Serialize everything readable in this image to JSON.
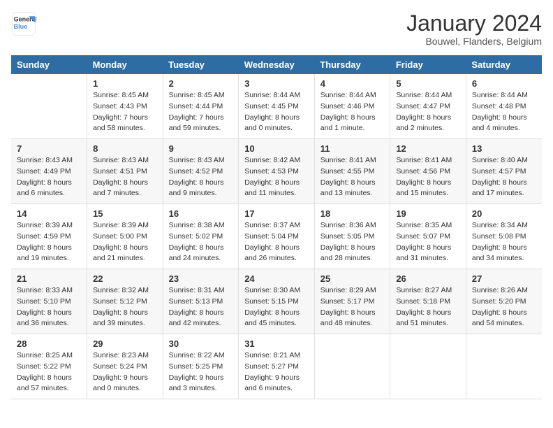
{
  "header": {
    "logo_line1": "General",
    "logo_line2": "Blue",
    "month": "January 2024",
    "location": "Bouwel, Flanders, Belgium"
  },
  "weekdays": [
    "Sunday",
    "Monday",
    "Tuesday",
    "Wednesday",
    "Thursday",
    "Friday",
    "Saturday"
  ],
  "weeks": [
    [
      {
        "num": "",
        "detail": ""
      },
      {
        "num": "1",
        "detail": "Sunrise: 8:45 AM\nSunset: 4:43 PM\nDaylight: 7 hours\nand 58 minutes."
      },
      {
        "num": "2",
        "detail": "Sunrise: 8:45 AM\nSunset: 4:44 PM\nDaylight: 7 hours\nand 59 minutes."
      },
      {
        "num": "3",
        "detail": "Sunrise: 8:44 AM\nSunset: 4:45 PM\nDaylight: 8 hours\nand 0 minutes."
      },
      {
        "num": "4",
        "detail": "Sunrise: 8:44 AM\nSunset: 4:46 PM\nDaylight: 8 hours\nand 1 minute."
      },
      {
        "num": "5",
        "detail": "Sunrise: 8:44 AM\nSunset: 4:47 PM\nDaylight: 8 hours\nand 2 minutes."
      },
      {
        "num": "6",
        "detail": "Sunrise: 8:44 AM\nSunset: 4:48 PM\nDaylight: 8 hours\nand 4 minutes."
      }
    ],
    [
      {
        "num": "7",
        "detail": "Sunrise: 8:43 AM\nSunset: 4:49 PM\nDaylight: 8 hours\nand 6 minutes."
      },
      {
        "num": "8",
        "detail": "Sunrise: 8:43 AM\nSunset: 4:51 PM\nDaylight: 8 hours\nand 7 minutes."
      },
      {
        "num": "9",
        "detail": "Sunrise: 8:43 AM\nSunset: 4:52 PM\nDaylight: 8 hours\nand 9 minutes."
      },
      {
        "num": "10",
        "detail": "Sunrise: 8:42 AM\nSunset: 4:53 PM\nDaylight: 8 hours\nand 11 minutes."
      },
      {
        "num": "11",
        "detail": "Sunrise: 8:41 AM\nSunset: 4:55 PM\nDaylight: 8 hours\nand 13 minutes."
      },
      {
        "num": "12",
        "detail": "Sunrise: 8:41 AM\nSunset: 4:56 PM\nDaylight: 8 hours\nand 15 minutes."
      },
      {
        "num": "13",
        "detail": "Sunrise: 8:40 AM\nSunset: 4:57 PM\nDaylight: 8 hours\nand 17 minutes."
      }
    ],
    [
      {
        "num": "14",
        "detail": "Sunrise: 8:39 AM\nSunset: 4:59 PM\nDaylight: 8 hours\nand 19 minutes."
      },
      {
        "num": "15",
        "detail": "Sunrise: 8:39 AM\nSunset: 5:00 PM\nDaylight: 8 hours\nand 21 minutes."
      },
      {
        "num": "16",
        "detail": "Sunrise: 8:38 AM\nSunset: 5:02 PM\nDaylight: 8 hours\nand 24 minutes."
      },
      {
        "num": "17",
        "detail": "Sunrise: 8:37 AM\nSunset: 5:04 PM\nDaylight: 8 hours\nand 26 minutes."
      },
      {
        "num": "18",
        "detail": "Sunrise: 8:36 AM\nSunset: 5:05 PM\nDaylight: 8 hours\nand 28 minutes."
      },
      {
        "num": "19",
        "detail": "Sunrise: 8:35 AM\nSunset: 5:07 PM\nDaylight: 8 hours\nand 31 minutes."
      },
      {
        "num": "20",
        "detail": "Sunrise: 8:34 AM\nSunset: 5:08 PM\nDaylight: 8 hours\nand 34 minutes."
      }
    ],
    [
      {
        "num": "21",
        "detail": "Sunrise: 8:33 AM\nSunset: 5:10 PM\nDaylight: 8 hours\nand 36 minutes."
      },
      {
        "num": "22",
        "detail": "Sunrise: 8:32 AM\nSunset: 5:12 PM\nDaylight: 8 hours\nand 39 minutes."
      },
      {
        "num": "23",
        "detail": "Sunrise: 8:31 AM\nSunset: 5:13 PM\nDaylight: 8 hours\nand 42 minutes."
      },
      {
        "num": "24",
        "detail": "Sunrise: 8:30 AM\nSunset: 5:15 PM\nDaylight: 8 hours\nand 45 minutes."
      },
      {
        "num": "25",
        "detail": "Sunrise: 8:29 AM\nSunset: 5:17 PM\nDaylight: 8 hours\nand 48 minutes."
      },
      {
        "num": "26",
        "detail": "Sunrise: 8:27 AM\nSunset: 5:18 PM\nDaylight: 8 hours\nand 51 minutes."
      },
      {
        "num": "27",
        "detail": "Sunrise: 8:26 AM\nSunset: 5:20 PM\nDaylight: 8 hours\nand 54 minutes."
      }
    ],
    [
      {
        "num": "28",
        "detail": "Sunrise: 8:25 AM\nSunset: 5:22 PM\nDaylight: 8 hours\nand 57 minutes."
      },
      {
        "num": "29",
        "detail": "Sunrise: 8:23 AM\nSunset: 5:24 PM\nDaylight: 9 hours\nand 0 minutes."
      },
      {
        "num": "30",
        "detail": "Sunrise: 8:22 AM\nSunset: 5:25 PM\nDaylight: 9 hours\nand 3 minutes."
      },
      {
        "num": "31",
        "detail": "Sunrise: 8:21 AM\nSunset: 5:27 PM\nDaylight: 9 hours\nand 6 minutes."
      },
      {
        "num": "",
        "detail": ""
      },
      {
        "num": "",
        "detail": ""
      },
      {
        "num": "",
        "detail": ""
      }
    ]
  ]
}
